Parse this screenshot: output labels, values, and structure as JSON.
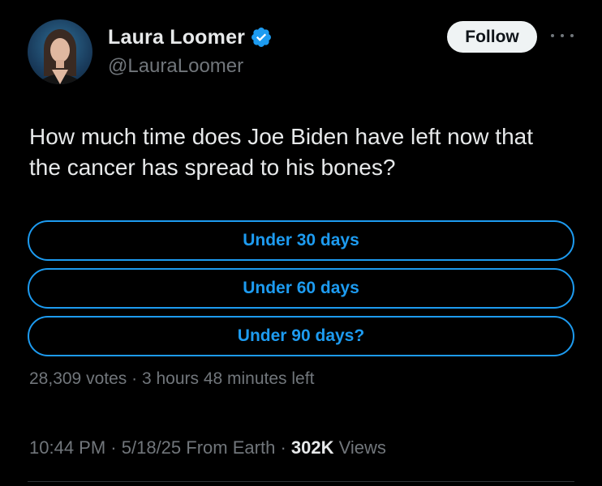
{
  "author": {
    "display_name": "Laura Loomer",
    "handle": "@LauraLoomer",
    "verified": true,
    "verified_color": "#1d9bf0"
  },
  "actions": {
    "follow_label": "Follow",
    "more_icon": "more-horizontal-icon"
  },
  "tweet": {
    "text": "How much time does Joe Biden have left now that the cancer has spread to his bones?"
  },
  "poll": {
    "options": [
      {
        "label": "Under 30 days"
      },
      {
        "label": "Under 60 days"
      },
      {
        "label": "Under 90 days?"
      }
    ],
    "votes": "28,309 votes",
    "separator": "·",
    "time_left": "3 hours 48 minutes left",
    "accent_color": "#1d9bf0"
  },
  "meta": {
    "time": "10:44 PM",
    "separator": "·",
    "date": "5/18/25",
    "source": "From Earth",
    "views_count": "302K",
    "views_label": "Views"
  },
  "colors": {
    "background": "#000000",
    "text_primary": "#e7e9ea",
    "text_secondary": "#71767b",
    "accent": "#1d9bf0"
  }
}
